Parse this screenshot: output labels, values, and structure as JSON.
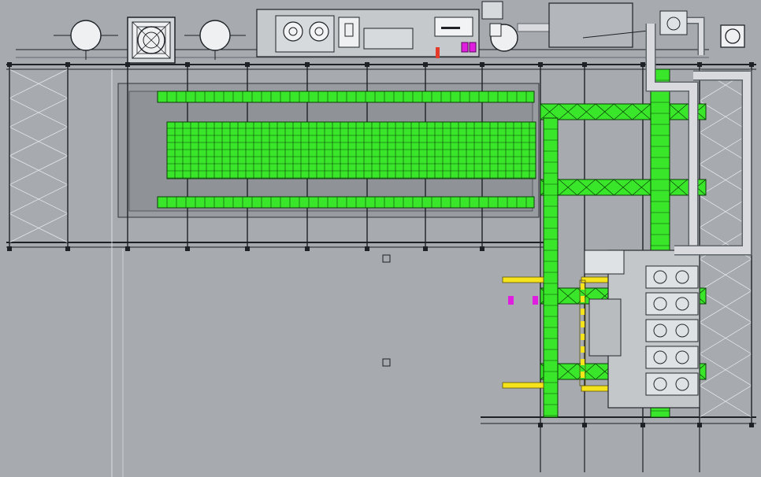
{
  "viewport": {
    "background": "#a7abb0",
    "projection": "Top",
    "display_mode": "Shaded"
  },
  "colors": {
    "canvas": "#a7abb0",
    "steel": "#1e2226",
    "steel_light": "#e9ecef",
    "floor_slab": "#989ca1",
    "conveyor_fill": "#39e62a",
    "conveyor_edge": "#0b3d06",
    "yellow_marker": "#f5e31c",
    "magenta_marker": "#e01ee0",
    "pipe": "#d8dadd",
    "pipe_edge": "#5e6469",
    "equipment": "#dfe2e5",
    "equipment_edge": "#26292c"
  },
  "components": [
    {
      "id": "tank-1",
      "type": "circular tank"
    },
    {
      "id": "mixing-unit",
      "type": "square mixer"
    },
    {
      "id": "tank-2",
      "type": "circular tank"
    },
    {
      "id": "control-panel",
      "type": "control cabinet"
    },
    {
      "id": "tank-3",
      "type": "circular tank"
    },
    {
      "id": "exhaust-box",
      "type": "duct housing"
    },
    {
      "id": "pump-unit",
      "type": "pump"
    },
    {
      "id": "main-conveyor",
      "type": "roller conveyor"
    },
    {
      "id": "cross-conveyors",
      "type": "transfer conveyor",
      "count": 4
    },
    {
      "id": "vertical-conveyors",
      "type": "roller conveyor",
      "count": 2
    },
    {
      "id": "process-machinery",
      "type": "stacked units"
    },
    {
      "id": "pipe-run",
      "type": "piping"
    }
  ],
  "icons": [
    "tank-icon",
    "fan-icon",
    "motor-icon",
    "pump-icon"
  ]
}
